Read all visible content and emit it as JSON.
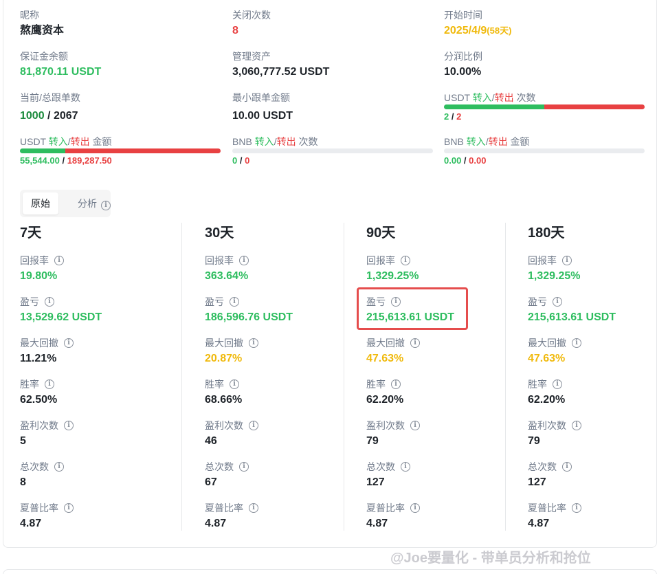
{
  "top": {
    "nickname": {
      "label": "昵称",
      "value": "熬鹰资本"
    },
    "close_count": {
      "label": "关闭次数",
      "value": "8"
    },
    "start_time": {
      "label": "开始时间",
      "value": "2025/4/9",
      "days": "(58天)"
    },
    "margin_balance": {
      "label": "保证金余额",
      "value": "81,870.11 USDT"
    },
    "aum": {
      "label": "管理资产",
      "value": "3,060,777.52 USDT"
    },
    "profit_share": {
      "label": "分润比例",
      "value": "10.00%"
    },
    "copy_orders": {
      "label": "当前/总跟单数",
      "current": "1000",
      "sep": " / ",
      "total": "2067"
    },
    "min_copy": {
      "label": "最小跟单金额",
      "value": "10.00 USDT"
    },
    "usdt_count": {
      "label_prefix": "USDT ",
      "in": "转入",
      "slash": "/",
      "out": "转出",
      "label_suffix": " 次数",
      "in_value": "2",
      "sep": " / ",
      "out_value": "2",
      "in_fraction": 0.5
    },
    "usdt_amount": {
      "label_prefix": "USDT ",
      "in": "转入",
      "slash": "/",
      "out": "转出",
      "label_suffix": " 金额",
      "in_value": "55,544.00",
      "sep": " / ",
      "out_value": "189,287.50",
      "in_fraction": 0.227
    },
    "bnb_count": {
      "label_prefix": "BNB ",
      "in": "转入",
      "slash": "/",
      "out": "转出",
      "label_suffix": " 次数",
      "in_value": "0",
      "sep": " / ",
      "out_value": "0"
    },
    "bnb_amount": {
      "label_prefix": "BNB ",
      "in": "转入",
      "slash": "/",
      "out": "转出",
      "label_suffix": " 金额",
      "in_value": "0.00",
      "sep": " / ",
      "out_value": "0.00"
    }
  },
  "tabs": {
    "original": "原始",
    "analysis": "分析"
  },
  "metric_labels": {
    "return": "回报率",
    "pnl": "盈亏",
    "max_drawdown": "最大回撤",
    "win_rate": "胜率",
    "win_count": "盈利次数",
    "total_count": "总次数",
    "sharpe": "夏普比率"
  },
  "periods": [
    {
      "title": "7天",
      "return": "19.80%",
      "pnl": "13,529.62 USDT",
      "max_drawdown": "11.21%",
      "win_rate": "62.50%",
      "win_count": "5",
      "total_count": "8",
      "sharpe": "4.87"
    },
    {
      "title": "30天",
      "return": "363.64%",
      "pnl": "186,596.76 USDT",
      "max_drawdown": "20.87%",
      "win_rate": "68.66%",
      "win_count": "46",
      "total_count": "67",
      "sharpe": "4.87"
    },
    {
      "title": "90天",
      "return": "1,329.25%",
      "pnl": "215,613.61 USDT",
      "max_drawdown": "47.63%",
      "win_rate": "62.20%",
      "win_count": "79",
      "total_count": "127",
      "sharpe": "4.87"
    },
    {
      "title": "180天",
      "return": "1,329.25%",
      "pnl": "215,613.61 USDT",
      "max_drawdown": "47.63%",
      "win_rate": "62.20%",
      "win_count": "79",
      "total_count": "127",
      "sharpe": "4.87"
    }
  ],
  "watermark": "@Joe要量化 - 带单员分析和抢位",
  "colors": {
    "green": "#2ebd5f",
    "red": "#e84142",
    "orange": "#f0b90b",
    "highlight": "#e54d4d"
  }
}
